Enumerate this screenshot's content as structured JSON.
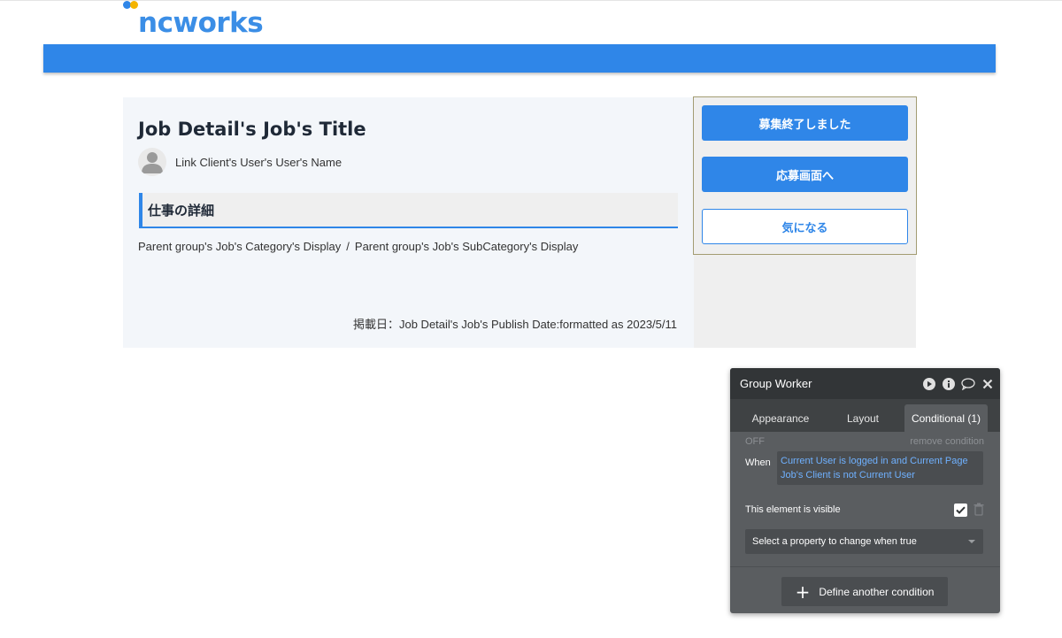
{
  "colors": {
    "brand_blue": "#2f86e8",
    "logo_blue": "#3b8ee6",
    "logo_dot_yellow": "#f4b400",
    "logo_dot_blue": "#2f86e8",
    "card_bg": "#f3f6fa",
    "panel_bg": "#5a5d60",
    "panel_header_bg": "#323537",
    "link_blue": "#6fb1ff"
  },
  "header": {
    "logo_text": "ncworks"
  },
  "job": {
    "title": "Job Detail's Job's Title",
    "client_name": "Link Client's User's User's Name",
    "section_title": "仕事の詳細",
    "category": "Parent group's Job's Category's Display",
    "category_separator": "/",
    "subcategory": "Parent group's Job's SubCategory's Display",
    "publish_date": "掲載日：Job Detail's Job's Publish Date:formatted as 2023/5/11"
  },
  "worker_group": {
    "closed_button": "募集終了しました",
    "apply_button": "応募画面へ",
    "favorite_button": "気になる"
  },
  "panel": {
    "title": "Group Worker",
    "icons": [
      "play-icon",
      "info-icon",
      "comment-icon",
      "close-icon"
    ],
    "tabs": [
      {
        "label": "Appearance",
        "active": false
      },
      {
        "label": "Layout",
        "active": false
      },
      {
        "label": "Conditional (1)",
        "active": true
      }
    ],
    "condition": {
      "status": "OFF",
      "remove_label": "remove condition",
      "when_label": "When",
      "expression": "Current User is logged in and Current Page Job's Client is not Current User",
      "visible_label": "This element is visible",
      "visible_checked": true,
      "select_placeholder": "Select a property to change when true"
    },
    "define_button": "Define another condition"
  }
}
